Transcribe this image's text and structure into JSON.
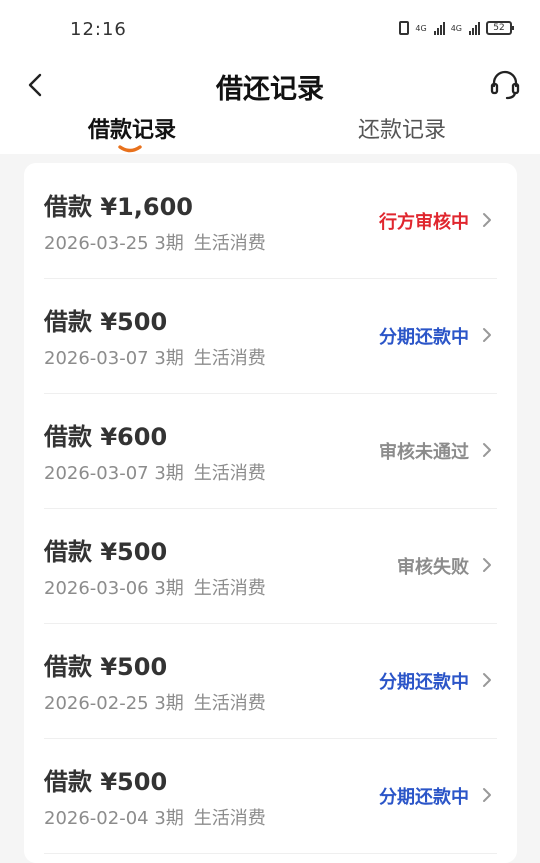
{
  "status_bar": {
    "time": "12:16",
    "network1": "4G",
    "network2": "4G",
    "battery": "52"
  },
  "header": {
    "title": "借还记录"
  },
  "tabs": [
    {
      "label": "借款记录",
      "active": true
    },
    {
      "label": "还款记录",
      "active": false
    }
  ],
  "colors": {
    "accent": "#e8711c",
    "status_red": "#e0262e",
    "status_blue": "#2b55c8",
    "status_gray": "#8c8c8c"
  },
  "loans": [
    {
      "amount": "借款 ¥1,600",
      "date": "2026-03-25 3期",
      "purpose": "生活消费",
      "status": "行方审核中",
      "status_color": "#e0262e"
    },
    {
      "amount": "借款 ¥500",
      "date": "2026-03-07 3期",
      "purpose": "生活消费",
      "status": "分期还款中",
      "status_color": "#2b55c8"
    },
    {
      "amount": "借款 ¥600",
      "date": "2026-03-07 3期",
      "purpose": "生活消费",
      "status": "审核未通过",
      "status_color": "#8c8c8c"
    },
    {
      "amount": "借款 ¥500",
      "date": "2026-03-06 3期",
      "purpose": "生活消费",
      "status": "审核失败",
      "status_color": "#8c8c8c"
    },
    {
      "amount": "借款 ¥500",
      "date": "2026-02-25 3期",
      "purpose": "生活消费",
      "status": "分期还款中",
      "status_color": "#2b55c8"
    },
    {
      "amount": "借款 ¥500",
      "date": "2026-02-04 3期",
      "purpose": "生活消费",
      "status": "分期还款中",
      "status_color": "#2b55c8"
    }
  ]
}
